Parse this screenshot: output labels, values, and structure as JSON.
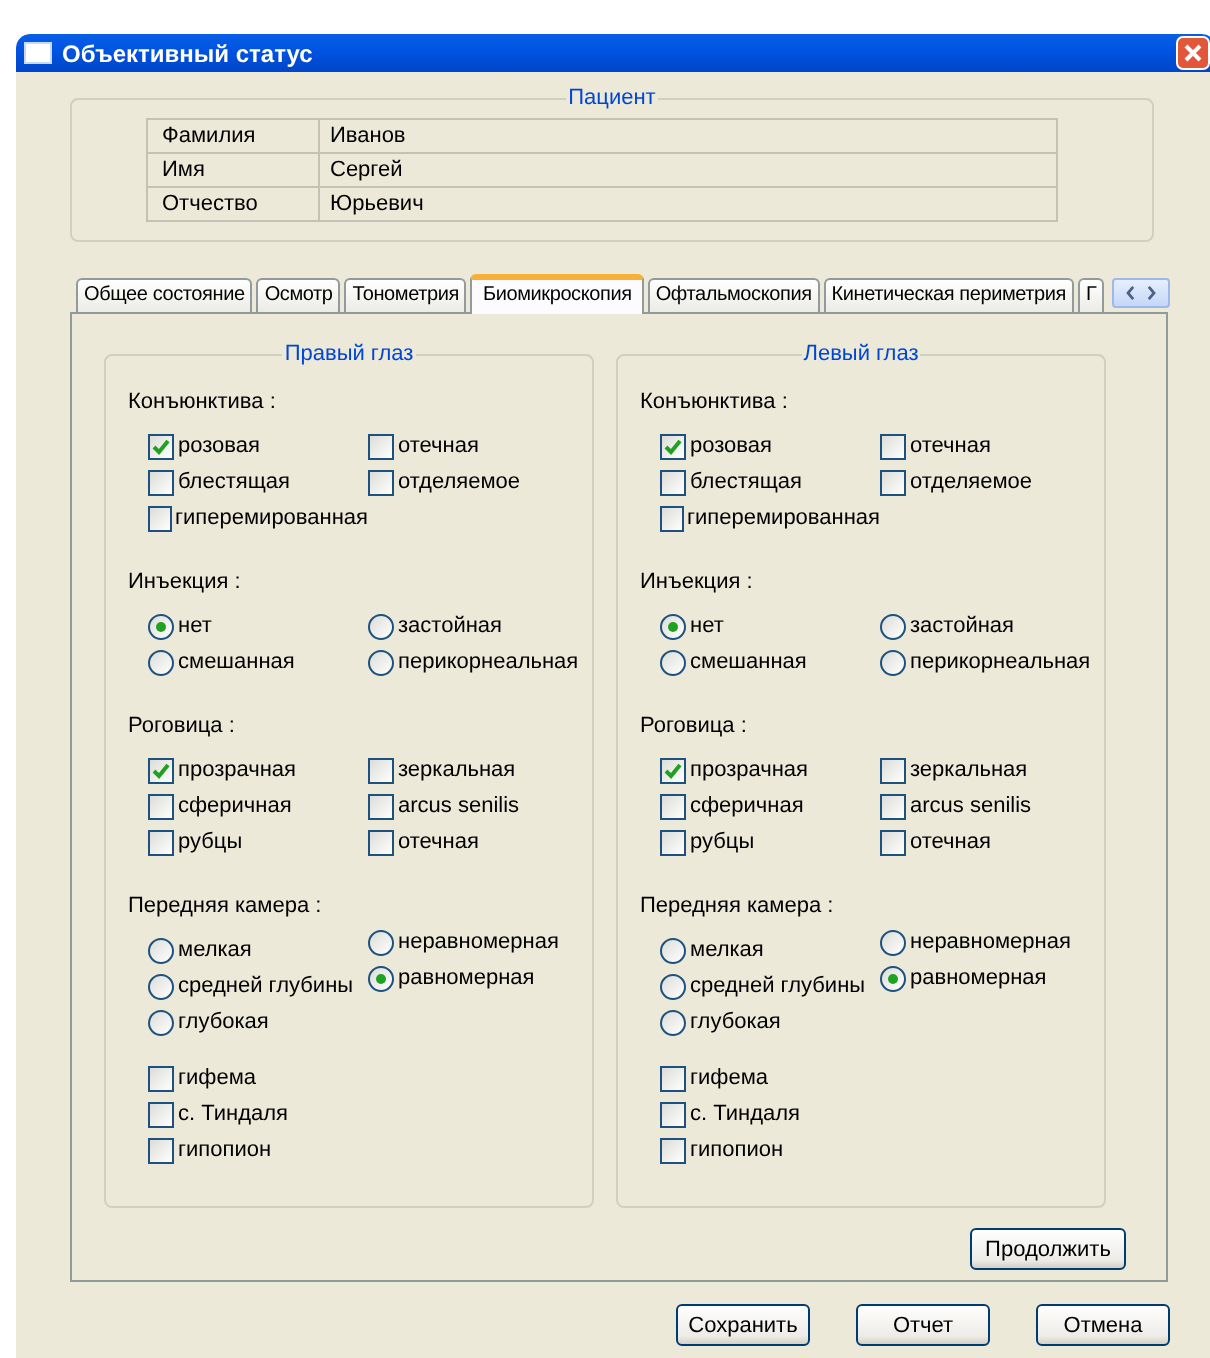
{
  "window": {
    "title": "Объективный статус"
  },
  "patient": {
    "title": "Пациент",
    "rows": [
      {
        "label": "Фамилия",
        "value": "Иванов"
      },
      {
        "label": "Имя",
        "value": "Сергей"
      },
      {
        "label": "Отчество",
        "value": "Юрьевич"
      }
    ]
  },
  "tabs": [
    {
      "label": "Общее состояние",
      "selected": false
    },
    {
      "label": "Осмотр",
      "selected": false
    },
    {
      "label": "Тонометрия",
      "selected": false
    },
    {
      "label": "Биомикроскопия",
      "selected": true
    },
    {
      "label": "Офтальмоскопия",
      "selected": false
    },
    {
      "label": "Кинетическая периметрия",
      "selected": false
    },
    {
      "label": "Г",
      "selected": false
    }
  ],
  "eyes": [
    {
      "title": "Правый глаз",
      "sections": [
        {
          "title": "Конъюнктива :",
          "kind": "checkbox",
          "columns": [
            [
              {
                "label": "розовая",
                "checked": true
              },
              {
                "label": "блестящая",
                "checked": false
              },
              {
                "label": "гиперемированная",
                "checked": false
              }
            ],
            [
              {
                "label": "отечная",
                "checked": false
              },
              {
                "label": "отделяемое",
                "checked": false
              }
            ]
          ]
        },
        {
          "title": "Инъекция :",
          "kind": "radio",
          "columns": [
            [
              {
                "label": "нет",
                "selected": true
              },
              {
                "label": "смешанная",
                "selected": false
              }
            ],
            [
              {
                "label": "застойная",
                "selected": false
              },
              {
                "label": "перикорнеальная",
                "selected": false
              }
            ]
          ]
        },
        {
          "title": "Роговица :",
          "kind": "checkbox",
          "columns": [
            [
              {
                "label": "прозрачная",
                "checked": true
              },
              {
                "label": "сферичная",
                "checked": false
              },
              {
                "label": "рубцы",
                "checked": false
              }
            ],
            [
              {
                "label": "зеркальная",
                "checked": false
              },
              {
                "label": "arcus senilis",
                "checked": false
              },
              {
                "label": "отечная",
                "checked": false
              }
            ]
          ]
        },
        {
          "title": "Передняя камера :",
          "kind": "radio",
          "columns": [
            [
              {
                "label": "мелкая",
                "selected": false
              },
              {
                "label": "средней глубины",
                "selected": false
              },
              {
                "label": "глубокая",
                "selected": false
              }
            ],
            [
              {
                "label": "неравномерная",
                "selected": false
              },
              {
                "label": "равномерная",
                "selected": true
              }
            ]
          ]
        },
        {
          "kind": "checkbox",
          "columns": [
            [
              {
                "label": "гифема",
                "checked": false
              },
              {
                "label": "с. Тиндаля",
                "checked": false
              },
              {
                "label": "гипопион",
                "checked": false
              }
            ]
          ]
        }
      ]
    },
    {
      "title": "Левый глаз",
      "sections": [
        {
          "title": "Конъюнктива :",
          "kind": "checkbox",
          "columns": [
            [
              {
                "label": "розовая",
                "checked": true
              },
              {
                "label": "блестящая",
                "checked": false
              },
              {
                "label": "гиперемированная",
                "checked": false
              }
            ],
            [
              {
                "label": "отечная",
                "checked": false
              },
              {
                "label": "отделяемое",
                "checked": false
              }
            ]
          ]
        },
        {
          "title": "Инъекция :",
          "kind": "radio",
          "columns": [
            [
              {
                "label": "нет",
                "selected": true
              },
              {
                "label": "смешанная",
                "selected": false
              }
            ],
            [
              {
                "label": "застойная",
                "selected": false
              },
              {
                "label": "перикорнеальная",
                "selected": false
              }
            ]
          ]
        },
        {
          "title": "Роговица :",
          "kind": "checkbox",
          "columns": [
            [
              {
                "label": "прозрачная",
                "checked": true
              },
              {
                "label": "сферичная",
                "checked": false
              },
              {
                "label": "рубцы",
                "checked": false
              }
            ],
            [
              {
                "label": "зеркальная",
                "checked": false
              },
              {
                "label": "arcus senilis",
                "checked": false
              },
              {
                "label": "отечная",
                "checked": false
              }
            ]
          ]
        },
        {
          "title": "Передняя камера :",
          "kind": "radio",
          "columns": [
            [
              {
                "label": "мелкая",
                "selected": false
              },
              {
                "label": "средней глубины",
                "selected": false
              },
              {
                "label": "глубокая",
                "selected": false
              }
            ],
            [
              {
                "label": "неравномерная",
                "selected": false
              },
              {
                "label": "равномерная",
                "selected": true
              }
            ]
          ]
        },
        {
          "kind": "checkbox",
          "columns": [
            [
              {
                "label": "гифема",
                "checked": false
              },
              {
                "label": "с. Тиндаля",
                "checked": false
              },
              {
                "label": "гипопион",
                "checked": false
              }
            ]
          ]
        }
      ]
    }
  ],
  "continue_button": "Продолжить",
  "buttons": [
    "Сохранить",
    "Отчет",
    "Отмена"
  ]
}
